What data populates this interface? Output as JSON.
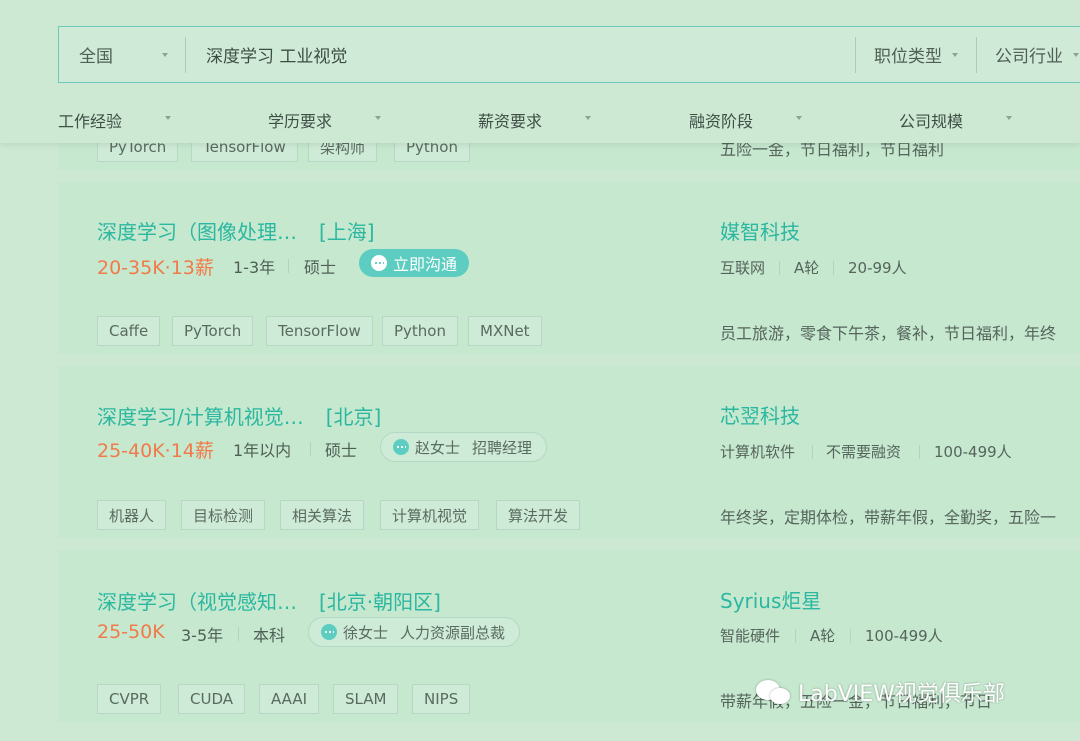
{
  "search": {
    "city": "全国",
    "query": "深度学习 工业视觉",
    "dropdowns": [
      "职位类型",
      "公司行业"
    ]
  },
  "filters": [
    "工作经验",
    "学历要求",
    "薪资要求",
    "融资阶段",
    "公司规模"
  ],
  "partial_card": {
    "tags": [
      "PyTorch",
      "TensorFlow",
      "架构师",
      "Python"
    ],
    "benefits": "五险一金，节日福利，节日福利"
  },
  "jobs": [
    {
      "title": "深度学习（图像处理…",
      "location": "[上海]",
      "salary": "20-35K·13薪",
      "experience": "1-3年",
      "education": "硕士",
      "chat_label": "立即沟通",
      "company": "媒智科技",
      "company_meta": [
        "互联网",
        "A轮",
        "20-99人"
      ],
      "tags": [
        "Caffe",
        "PyTorch",
        "TensorFlow",
        "Python",
        "MXNet"
      ],
      "benefits": "员工旅游，零食下午茶，餐补，节日福利，年终"
    },
    {
      "title": "深度学习/计算机视觉…",
      "location": "[北京]",
      "salary": "25-40K·14薪",
      "experience": "1年以内",
      "education": "硕士",
      "recruiter_name": "赵女士",
      "recruiter_role": "招聘经理",
      "company": "芯翌科技",
      "company_meta": [
        "计算机软件",
        "不需要融资",
        "100-499人"
      ],
      "tags": [
        "机器人",
        "目标检测",
        "相关算法",
        "计算机视觉",
        "算法开发"
      ],
      "benefits": "年终奖，定期体检，带薪年假，全勤奖，五险一"
    },
    {
      "title": "深度学习（视觉感知…",
      "location": "[北京·朝阳区]",
      "salary": "25-50K",
      "experience": "3-5年",
      "education": "本科",
      "recruiter_name": "徐女士",
      "recruiter_role": "人力资源副总裁",
      "company": "Syrius炬星",
      "company_meta": [
        "智能硬件",
        "A轮",
        "100-499人"
      ],
      "tags": [
        "CVPR",
        "CUDA",
        "AAAI",
        "SLAM",
        "NIPS"
      ],
      "benefits": "带薪年假，五险一金，节日福利，节日"
    }
  ],
  "watermark": "LabVIEW视觉俱乐部"
}
